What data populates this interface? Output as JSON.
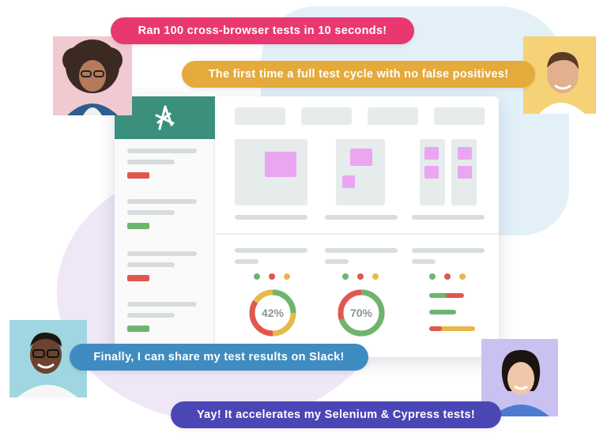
{
  "messages": {
    "m1": "Ran 100 cross-browser tests in 10 seconds!",
    "m2": "The first time a full test cycle with no false positives!",
    "m3": "Finally, I can share my test results on Slack!",
    "m4": "Yay! It accelerates my Selenium & Cypress tests!"
  },
  "dashboard": {
    "donut1_label": "42%",
    "donut2_label": "70%",
    "donut1_progress": 0.42,
    "donut2_progress": 0.7
  },
  "colors": {
    "pink": "#e9386f",
    "gold": "#e5aa3c",
    "blue": "#3f8cc0",
    "indigo": "#4b46b6",
    "teal": "#3b8f7d",
    "green": "#6db56e",
    "red": "#e0574f",
    "yellow": "#e7b84a"
  },
  "icons": {
    "logo": "logo-icon"
  }
}
